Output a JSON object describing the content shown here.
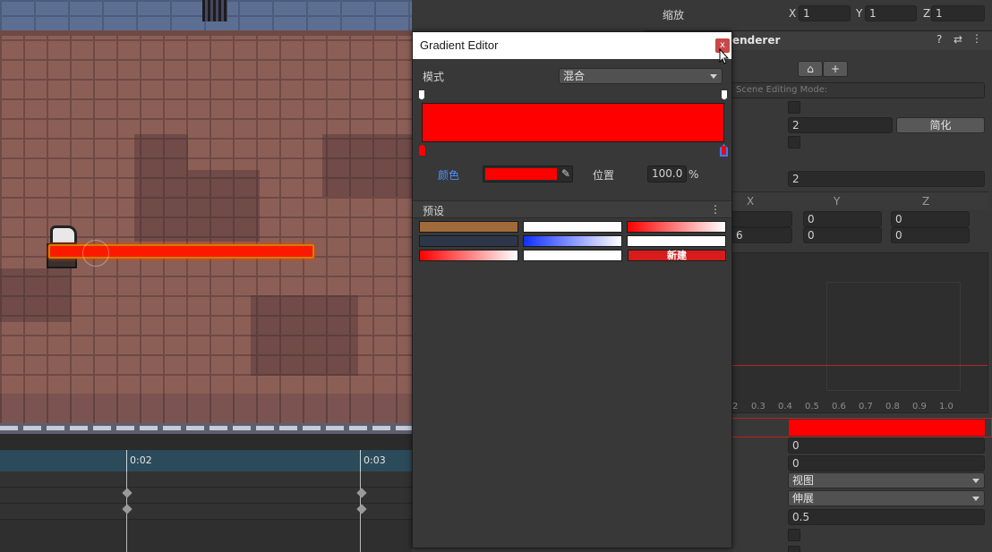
{
  "inspector": {
    "scale_label": "缩放",
    "scale": {
      "x_label": "X",
      "x": "1",
      "y_label": "Y",
      "y": "1",
      "z_label": "Z",
      "z": "1"
    },
    "component_title": "enderer",
    "scene_editing_mode": "Scene Editing Mode:",
    "field_2a": "2",
    "simplify_button": "简化",
    "field_2b": "2",
    "column_headers": [
      "X",
      "Y",
      "Z"
    ],
    "row1": [
      "0",
      "0"
    ],
    "row2": [
      "6",
      "0",
      "0"
    ],
    "axis_ticks": [
      "2",
      "0.3",
      "0.4",
      "0.5",
      "0.6",
      "0.7",
      "0.8",
      "0.9",
      "1.0"
    ],
    "field_0a": "0",
    "field_0b": "0",
    "alignment_value": "视图",
    "texture_mode_value": "伸展",
    "field_05": "0.5",
    "gradient_color": "#ff0000"
  },
  "gradient_editor": {
    "title": "Gradient Editor",
    "close_glyph": "x",
    "mode_label": "模式",
    "mode_value": "混合",
    "color_label": "颜色",
    "color_value": "#ff0000",
    "eyedropper_glyph": "✎",
    "location_label": "位置",
    "location_value": "100.0",
    "percent": "%",
    "presets_label": "预设",
    "presets_menu_glyph": "⋮",
    "new_label": "新建",
    "presets": [
      {
        "name": "brown",
        "gradient": "linear-gradient(90deg,#a06a3a,#a06a3a)"
      },
      {
        "name": "white",
        "gradient": "linear-gradient(90deg,#ffffff,#ffffff)"
      },
      {
        "name": "red-to-white",
        "gradient": "linear-gradient(90deg,#ff0000,#ffffff)"
      },
      {
        "name": "dark-slate",
        "gradient": "linear-gradient(90deg,#2c3648,#2c3648)"
      },
      {
        "name": "blue-to-white",
        "gradient": "linear-gradient(90deg,#1030ff,#ffffff)"
      },
      {
        "name": "white-2",
        "gradient": "linear-gradient(90deg,#ffffff,#ffffff)"
      },
      {
        "name": "red-to-white-2",
        "gradient": "linear-gradient(90deg,#ff0000,#ffffff)"
      },
      {
        "name": "white-3",
        "gradient": "linear-gradient(90deg,#ffffff,#ffffff)"
      }
    ]
  },
  "timeline": {
    "tick_labels": [
      "0:02",
      "0:03"
    ]
  },
  "colors": {
    "laser": "#fb1a00",
    "accent_red": "#ff0000",
    "panel_bg": "#383838"
  }
}
